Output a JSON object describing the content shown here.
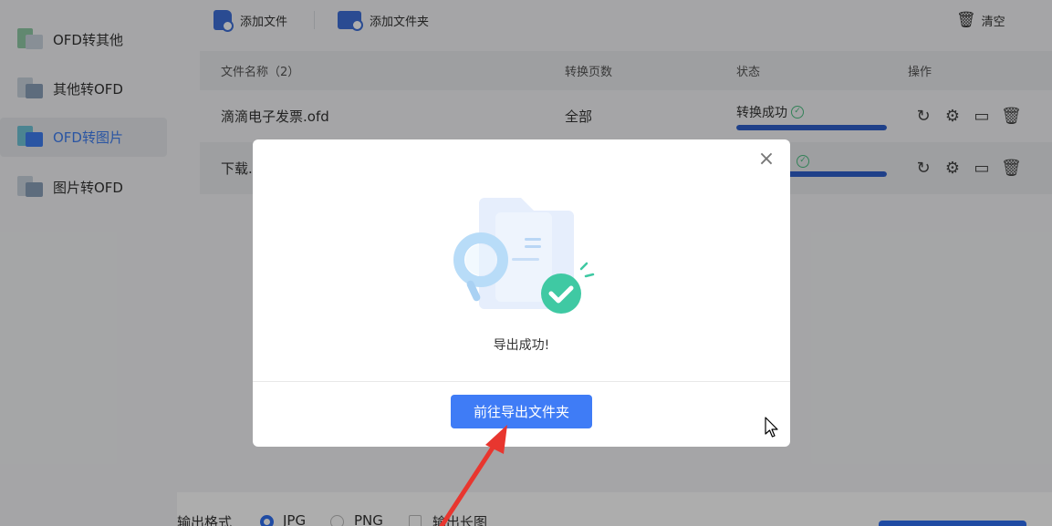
{
  "sidebar": {
    "items": [
      {
        "label": "OFD转其他",
        "icon": "ofd-to-other-icon",
        "active": false
      },
      {
        "label": "其他转OFD",
        "icon": "other-to-ofd-icon",
        "active": false
      },
      {
        "label": "OFD转图片",
        "icon": "ofd-to-image-icon",
        "active": true
      },
      {
        "label": "图片转OFD",
        "icon": "image-to-ofd-icon",
        "active": false
      }
    ]
  },
  "toolbar": {
    "add_file": "添加文件",
    "add_folder": "添加文件夹",
    "clear": "清空"
  },
  "table": {
    "headers": {
      "name": "文件名称（2）",
      "pages": "转换页数",
      "status": "状态",
      "ops": "操作"
    },
    "rows": [
      {
        "name": "滴滴电子发票.ofd",
        "pages": "全部",
        "status": "转换成功",
        "progress": 1.0
      },
      {
        "name": "下载.",
        "pages": "",
        "status": "",
        "progress": 1.0
      }
    ]
  },
  "bottom": {
    "output_format_label": "输出格式",
    "formats": [
      "JPG",
      "PNG"
    ],
    "selected": "JPG",
    "long_image_label": "输出长图"
  },
  "modal": {
    "message": "导出成功!",
    "button": "前往导出文件夹"
  },
  "colors": {
    "accent": "#3f7cf6",
    "success": "#4cbf82",
    "progress": "#2f5fcb"
  }
}
